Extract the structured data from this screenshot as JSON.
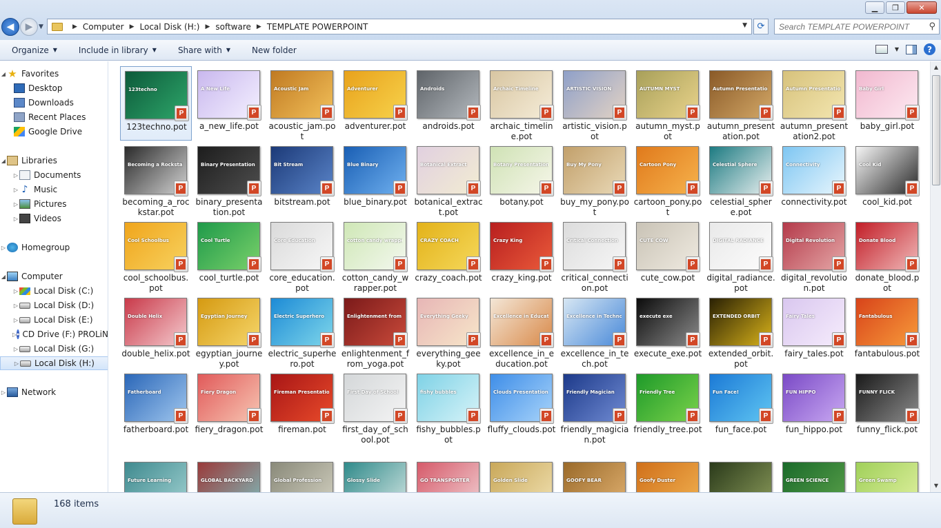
{
  "window": {
    "minimize": "▁",
    "maximize": "❐",
    "close": "✕"
  },
  "address": {
    "crumbs": [
      "Computer",
      "Local Disk (H:)",
      "software",
      "TEMPLATE POWERPOINT"
    ]
  },
  "search": {
    "placeholder": "Search TEMPLATE POWERPOINT"
  },
  "toolbar": {
    "organize": "Organize",
    "include_in_library": "Include in library",
    "share_with": "Share with",
    "new_folder": "New folder"
  },
  "sidebar": {
    "favorites": "Favorites",
    "favorites_items": [
      "Desktop",
      "Downloads",
      "Recent Places",
      "Google Drive"
    ],
    "libraries": "Libraries",
    "library_items": [
      "Documents",
      "Music",
      "Pictures",
      "Videos"
    ],
    "homegroup": "Homegroup",
    "computer": "Computer",
    "computer_items": [
      "Local Disk (C:)",
      "Local Disk (D:)",
      "Local Disk (E:)",
      "CD Drive (F:) PROLiN",
      "Local Disk (G:)",
      "Local Disk (H:)"
    ],
    "network": "Network"
  },
  "files": [
    {
      "name": "123techno.pot",
      "thumb": "123techno",
      "colors": [
        "#0c5a3a",
        "#2ea66a"
      ]
    },
    {
      "name": "a_new_life.pot",
      "thumb": "A New Life",
      "colors": [
        "#c9b8ee",
        "#f4f0ff"
      ]
    },
    {
      "name": "acoustic_jam.pot",
      "thumb": "Acoustic Jam",
      "colors": [
        "#c07a22",
        "#f2c05a"
      ]
    },
    {
      "name": "adventurer.pot",
      "thumb": "Adventurer",
      "colors": [
        "#e8a21c",
        "#f7d24b"
      ]
    },
    {
      "name": "androids.pot",
      "thumb": "Androids",
      "colors": [
        "#5f6469",
        "#b3b8bd"
      ]
    },
    {
      "name": "archaic_timeline.pot",
      "thumb": "Archaic Timeline",
      "colors": [
        "#d8c6a2",
        "#f5ecd8"
      ]
    },
    {
      "name": "artistic_vision.pot",
      "thumb": "ARTISTIC VISION",
      "colors": [
        "#8fa0c8",
        "#e2d2c4"
      ]
    },
    {
      "name": "autumn_myst.pot",
      "thumb": "AUTUMN MYST",
      "colors": [
        "#a8a05a",
        "#e9d38b"
      ]
    },
    {
      "name": "autumn_presentation.pot",
      "thumb": "Autumn Presentation",
      "colors": [
        "#8a5a28",
        "#d3a867"
      ]
    },
    {
      "name": "autumn_presentation2.pot",
      "thumb": "Autumn Presentation",
      "colors": [
        "#d7c27c",
        "#f3e6b0"
      ]
    },
    {
      "name": "baby_girl.pot",
      "thumb": "Baby Girl",
      "colors": [
        "#f1b8cf",
        "#fde9f1"
      ]
    },
    {
      "name": "becoming_a_rockstar.pot",
      "thumb": "Becoming a Rockstar",
      "colors": [
        "#2b2b2b",
        "#d1d1d1"
      ]
    },
    {
      "name": "binary_presentation.pot",
      "thumb": "Binary Presentation",
      "colors": [
        "#1d1d1d",
        "#4e4e4e"
      ]
    },
    {
      "name": "bitstream.pot",
      "thumb": "Bit Stream",
      "colors": [
        "#1c3a78",
        "#5a84c8"
      ]
    },
    {
      "name": "blue_binary.pot",
      "thumb": "Blue Binary",
      "colors": [
        "#1a5fb4",
        "#6fb0ef"
      ]
    },
    {
      "name": "botanical_extract.pot",
      "thumb": "Botanical Extract",
      "colors": [
        "#e1d0e0",
        "#f2ecd2"
      ]
    },
    {
      "name": "botany.pot",
      "thumb": "Botany Presentation",
      "colors": [
        "#cfe2b5",
        "#f6f6e9"
      ]
    },
    {
      "name": "buy_my_pony.pot",
      "thumb": "Buy My Pony",
      "colors": [
        "#c2a06b",
        "#e9d9b7"
      ]
    },
    {
      "name": "cartoon_pony.pot",
      "thumb": "Cartoon Pony",
      "colors": [
        "#e07a1c",
        "#f6b24c"
      ]
    },
    {
      "name": "celestial_sphere.pot",
      "thumb": "Celestial Sphere",
      "colors": [
        "#1d7b82",
        "#e7eeee"
      ]
    },
    {
      "name": "connectivity.pot",
      "thumb": "Connectivity",
      "colors": [
        "#7ec6f2",
        "#e8f6fd"
      ]
    },
    {
      "name": "cool_kid.pot",
      "thumb": "Cool Kid",
      "colors": [
        "#f6f6f6",
        "#2a2a2a"
      ]
    },
    {
      "name": "cool_schoolbus.pot",
      "thumb": "Cool Schoolbus",
      "colors": [
        "#f0a51c",
        "#f7d25f"
      ]
    },
    {
      "name": "cool_turtle.pot",
      "thumb": "Cool Turtle",
      "colors": [
        "#1f9a4a",
        "#7ad16a"
      ]
    },
    {
      "name": "core_education.pot",
      "thumb": "Core Education",
      "colors": [
        "#dadada",
        "#f7f7f7"
      ]
    },
    {
      "name": "cotton_candy_wrapper.pot",
      "thumb": "cotton candy wrapper",
      "colors": [
        "#cfe7b6",
        "#f3f8ee"
      ]
    },
    {
      "name": "crazy_coach.pot",
      "thumb": "CRAZY COACH",
      "colors": [
        "#e3b21a",
        "#f5d85a"
      ]
    },
    {
      "name": "crazy_king.pot",
      "thumb": "Crazy King",
      "colors": [
        "#b81f1f",
        "#ea5a3a"
      ]
    },
    {
      "name": "critical_connection.pot",
      "thumb": "Critical Connection",
      "colors": [
        "#dcdcdc",
        "#f6f6f6"
      ]
    },
    {
      "name": "cute_cow.pot",
      "thumb": "CUTE COW",
      "colors": [
        "#c9c3b6",
        "#efeae0"
      ]
    },
    {
      "name": "digital_radiance.pot",
      "thumb": "DIGITAL RADIANCE",
      "colors": [
        "#e9e9e9",
        "#fcfcfc"
      ]
    },
    {
      "name": "digital_revolution.pot",
      "thumb": "Digital Revolution",
      "colors": [
        "#b43a4a",
        "#e5a7a7"
      ]
    },
    {
      "name": "donate_blood.pot",
      "thumb": "Donate Blood",
      "colors": [
        "#c21d27",
        "#f0b8b8"
      ]
    },
    {
      "name": "double_helix.pot",
      "thumb": "Double Helix",
      "colors": [
        "#c93a4a",
        "#f4c9cd"
      ]
    },
    {
      "name": "egyptian_journey.pot",
      "thumb": "Egyptian Journey",
      "colors": [
        "#d59a12",
        "#f6d66a"
      ]
    },
    {
      "name": "electric_superhero.pot",
      "thumb": "Electric Superhero",
      "colors": [
        "#1d8bd6",
        "#7ed6ea"
      ]
    },
    {
      "name": "enlightenment_from_yoga.pot",
      "thumb": "Enlightenment from Yoga",
      "colors": [
        "#7b1a1a",
        "#c94a3a"
      ]
    },
    {
      "name": "everything_geeky.pot",
      "thumb": "Everything Geeky",
      "colors": [
        "#e7b6b6",
        "#f7e6c9"
      ]
    },
    {
      "name": "excellence_in_education.pot",
      "thumb": "Excellence in Education",
      "colors": [
        "#f3e6d6",
        "#d98a4a"
      ]
    },
    {
      "name": "excellence_in_tech.pot",
      "thumb": "Excellence in Technology",
      "colors": [
        "#d6e6f3",
        "#4a8ad9"
      ]
    },
    {
      "name": "execute_exe.pot",
      "thumb": "execute exe",
      "colors": [
        "#0c0c0c",
        "#8a8a8a"
      ]
    },
    {
      "name": "extended_orbit.pot",
      "thumb": "EXTENDED ORBIT",
      "colors": [
        "#2a2104",
        "#d8b21a"
      ]
    },
    {
      "name": "fairy_tales.pot",
      "thumb": "Fairy Tales",
      "colors": [
        "#d9c7ef",
        "#f6ecfc"
      ]
    },
    {
      "name": "fantabulous.pot",
      "thumb": "Fantabulous",
      "colors": [
        "#d8441a",
        "#f79a3a"
      ]
    },
    {
      "name": "fatherboard.pot",
      "thumb": "Fatherboard",
      "colors": [
        "#2b67b8",
        "#9fc6ee"
      ]
    },
    {
      "name": "fiery_dragon.pot",
      "thumb": "Fiery Dragon",
      "colors": [
        "#e15a5a",
        "#f7c5b2"
      ]
    },
    {
      "name": "fireman.pot",
      "thumb": "Fireman Presentation",
      "colors": [
        "#a81616",
        "#e84a2a"
      ]
    },
    {
      "name": "first_day_of_school.pot",
      "thumb": "First Day of School",
      "colors": [
        "#d4d7d9",
        "#f4f4f4"
      ]
    },
    {
      "name": "fishy_bubbles.pot",
      "thumb": "fishy bubbles",
      "colors": [
        "#7fd2e6",
        "#d6f3f8"
      ]
    },
    {
      "name": "fluffy_clouds.pot",
      "thumb": "Clouds Presentation",
      "colors": [
        "#3f8ee8",
        "#a7d3fa"
      ]
    },
    {
      "name": "friendly_magician.pot",
      "thumb": "Friendly Magician",
      "colors": [
        "#1d3a8a",
        "#6f8ad2"
      ]
    },
    {
      "name": "friendly_tree.pot",
      "thumb": "Friendly Tree",
      "colors": [
        "#1e9a2a",
        "#7ad24a"
      ]
    },
    {
      "name": "fun_face.pot",
      "thumb": "Fun Face!",
      "colors": [
        "#1c7ad6",
        "#5fc5f2"
      ]
    },
    {
      "name": "fun_hippo.pot",
      "thumb": "FUN HIPPO",
      "colors": [
        "#7a4ac6",
        "#c9a8f2"
      ]
    },
    {
      "name": "funny_flick.pot",
      "thumb": "FUNNY FLICK",
      "colors": [
        "#1a1a1a",
        "#8a8a8a"
      ]
    },
    {
      "name": "",
      "thumb": "Future Learning",
      "colors": [
        "#3f8a8f",
        "#9fd0d0"
      ]
    },
    {
      "name": "",
      "thumb": "GLOBAL BACKYARD",
      "colors": [
        "#9a3a3a",
        "#7fb8b8"
      ]
    },
    {
      "name": "",
      "thumb": "Global Profession",
      "colors": [
        "#8a8a7a",
        "#d2d0c0"
      ]
    },
    {
      "name": "",
      "thumb": "Glossy Slide",
      "colors": [
        "#2f8a8a",
        "#cfe3e0"
      ]
    },
    {
      "name": "",
      "thumb": "GO TRANSPORTER",
      "colors": [
        "#d65a6a",
        "#f0cdd0"
      ]
    },
    {
      "name": "",
      "thumb": "Golden Slide",
      "colors": [
        "#c9a85a",
        "#f0e0b0"
      ]
    },
    {
      "name": "",
      "thumb": "GOOFY BEAR",
      "colors": [
        "#9a6a2a",
        "#e0b070"
      ]
    },
    {
      "name": "",
      "thumb": "Goofy Duster",
      "colors": [
        "#d0701a",
        "#f0b050"
      ]
    },
    {
      "name": "",
      "thumb": "",
      "colors": [
        "#2a3a1a",
        "#8a9a5a"
      ]
    },
    {
      "name": "",
      "thumb": "GREEN SCIENCE",
      "colors": [
        "#1a6a2a",
        "#5aa04a"
      ]
    },
    {
      "name": "",
      "thumb": "Green Swamp",
      "colors": [
        "#a0d05a",
        "#e0f0a0"
      ]
    }
  ],
  "status": {
    "item_count": "168 items"
  }
}
